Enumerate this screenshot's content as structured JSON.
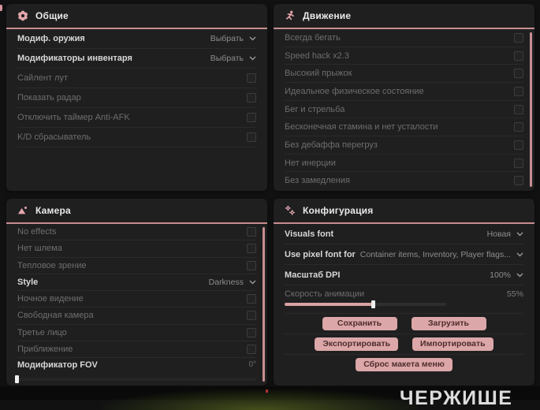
{
  "watermark": "ЧЕРЖИШЕ",
  "colors": {
    "accent_pink": "#c98e90",
    "button_bg": "#dca7a8",
    "button_text": "#4e2c2d",
    "panel_bg": "#1f1f20",
    "page_bg": "#111112",
    "slider_fill": "#d8a2a3"
  },
  "panels": {
    "general": {
      "title": "Общие",
      "icon": "flower-gear-icon",
      "rows": [
        {
          "label": "Модиф. оружия",
          "control": "dropdown",
          "value": "Выбрать"
        },
        {
          "label": "Модификаторы инвентаря",
          "control": "dropdown",
          "value": "Выбрать"
        },
        {
          "label": "Сайлент лут",
          "control": "checkbox",
          "checked": false
        },
        {
          "label": "Показать радар",
          "control": "checkbox",
          "checked": false
        },
        {
          "label": "Отключить таймер Anti-AFK",
          "control": "checkbox",
          "checked": false
        },
        {
          "label": "K/D сбрасыватель",
          "control": "checkbox",
          "checked": false
        }
      ]
    },
    "movement": {
      "title": "Движение",
      "icon": "runner-icon",
      "rows": [
        {
          "label": "Всегда бегать",
          "control": "checkbox",
          "checked": false
        },
        {
          "label": "Speed hack x2.3",
          "control": "checkbox",
          "checked": false
        },
        {
          "label": "Высокий прыжок",
          "control": "checkbox",
          "checked": false
        },
        {
          "label": "Идеальное физическое состояние",
          "control": "checkbox",
          "checked": false
        },
        {
          "label": "Бег и стрельба",
          "control": "checkbox",
          "checked": false
        },
        {
          "label": "Бесконечная стамина и нет усталости",
          "control": "checkbox",
          "checked": false
        },
        {
          "label": "Без дебаффа перегруз",
          "control": "checkbox",
          "checked": false
        },
        {
          "label": "Нет инерции",
          "control": "checkbox",
          "checked": false
        },
        {
          "label": "Без замедления",
          "control": "checkbox",
          "checked": false
        }
      ]
    },
    "camera": {
      "title": "Камера",
      "icon": "photo-icon",
      "rows": [
        {
          "label": "No effects",
          "control": "checkbox",
          "checked": false
        },
        {
          "label": "Нет шлема",
          "control": "checkbox",
          "checked": false
        },
        {
          "label": "Тепловое зрение",
          "control": "checkbox",
          "checked": false
        },
        {
          "label": "Style",
          "control": "dropdown",
          "value": "Darkness"
        },
        {
          "label": "Ночное видение",
          "control": "checkbox",
          "checked": false
        },
        {
          "label": "Свободная камера",
          "control": "checkbox",
          "checked": false
        },
        {
          "label": "Третье лицо",
          "control": "checkbox",
          "checked": false
        },
        {
          "label": "Приближение",
          "control": "checkbox",
          "checked": false
        },
        {
          "label": "Модификатор FOV",
          "control": "slider",
          "value": "0°",
          "percent": 0
        }
      ]
    },
    "config": {
      "title": "Конфигурация",
      "icon": "gears-icon",
      "rows": [
        {
          "label": "Visuals font",
          "control": "dropdown",
          "value": "Новая"
        },
        {
          "label": "Use pixel font for",
          "control": "dropdown",
          "value": "Container items, Inventory, Player flags..."
        },
        {
          "label": "Масштаб DPI",
          "control": "dropdown",
          "value": "100%"
        },
        {
          "label": "Скорость анимации",
          "control": "slider",
          "value": "55%",
          "percent": 55
        }
      ],
      "buttons": {
        "save": "Сохранить",
        "load": "Загрузить",
        "export": "Экспортировать",
        "import": "Импортировать",
        "reset_layout": "Сброс макета меню"
      }
    }
  }
}
